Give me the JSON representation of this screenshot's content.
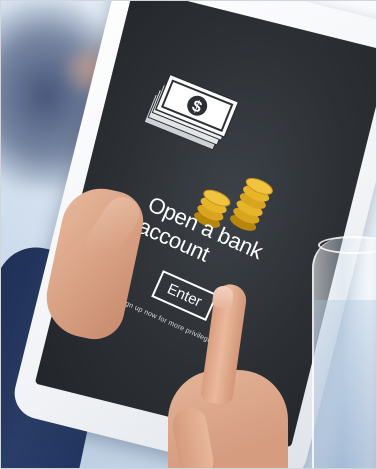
{
  "screen": {
    "headline": "Open a bank account",
    "button_label": "Enter",
    "subtext": "sign up now for more privileges"
  },
  "icons": {
    "cash": "dollar-bill-stack-icon",
    "coins": "coin-stack-icon"
  },
  "colors": {
    "screen": "#2c3035",
    "tablet_bezel": "#f1f3f6",
    "coin_gold": "#e6b52a",
    "sleeve": "#26385f",
    "skin": "#dca386"
  }
}
